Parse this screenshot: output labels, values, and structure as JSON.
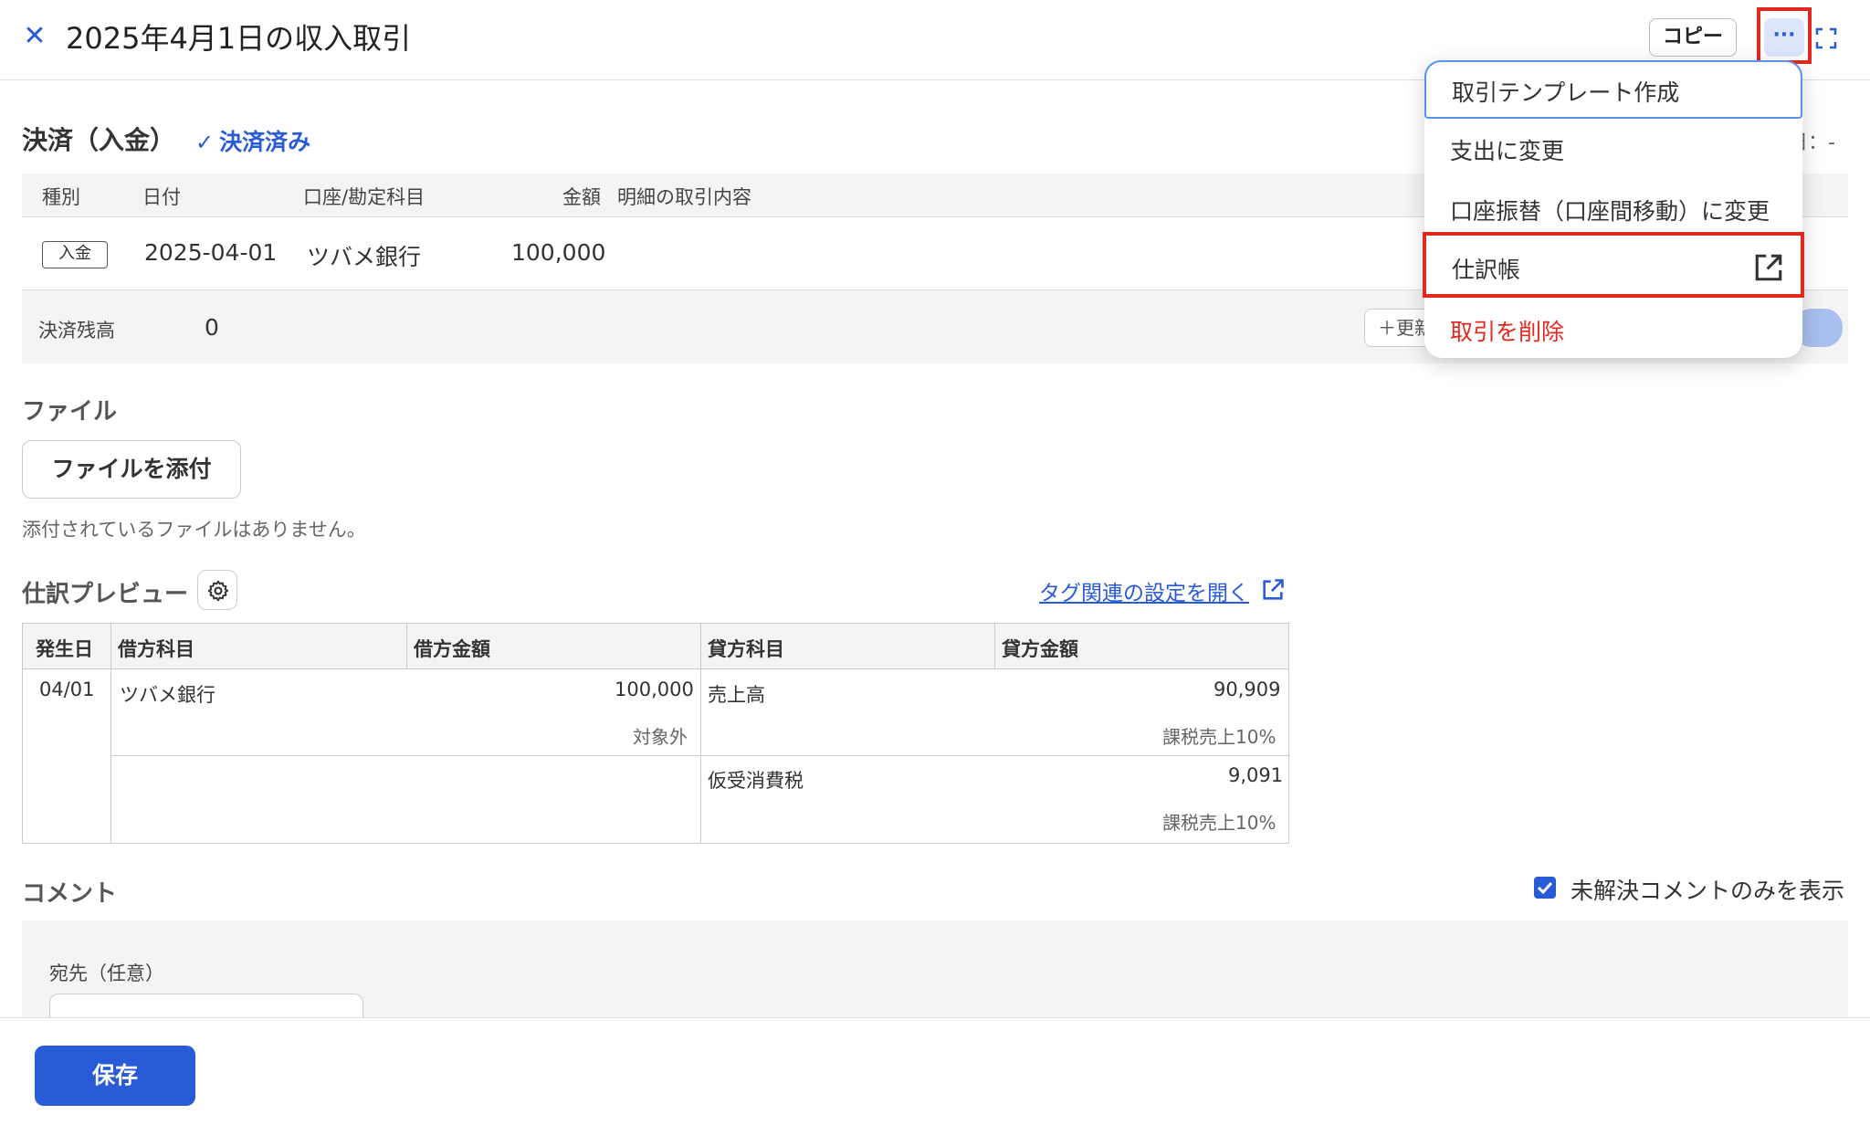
{
  "header": {
    "title": "2025年4月1日の収入取引",
    "copy_label": "コピー",
    "more_label": "···"
  },
  "settlement": {
    "title": "決済（入金）",
    "status": "決済済み",
    "right_text": "日：-",
    "columns": [
      "種別",
      "日付",
      "口座/勘定科目",
      "金額",
      "明細の取引内容"
    ],
    "row": {
      "type": "入金",
      "date": "2025-04-01",
      "account": "ツバメ銀行",
      "amount": "100,000"
    },
    "balance_label": "決済残高",
    "balance_value": "0",
    "update_label": "＋更新"
  },
  "files": {
    "title": "ファイル",
    "attach_label": "ファイルを添付",
    "note": "添付されているファイルはありません。"
  },
  "journal": {
    "title": "仕訳プレビュー",
    "tag_link": "タグ関連の設定を開く",
    "columns": [
      "発生日",
      "借方科目",
      "借方金額",
      "貸方科目",
      "貸方金額"
    ],
    "date": "04/01",
    "debit_account": "ツバメ銀行",
    "debit_amount": "100,000",
    "debit_tax": "対象外",
    "credit1_account": "売上高",
    "credit1_amount": "90,909",
    "credit1_tax": "課税売上10%",
    "credit2_account": "仮受消費税",
    "credit2_amount": "9,091",
    "credit2_tax": "課税売上10%"
  },
  "comment": {
    "title": "コメント",
    "filter_label": "未解決コメントのみを表示",
    "to_label": "宛先（任意）"
  },
  "footer": {
    "save_label": "保存"
  },
  "menu": {
    "items": [
      {
        "label": "取引テンプレート作成"
      },
      {
        "label": "支出に変更"
      },
      {
        "label": "口座振替（口座間移動）に変更"
      },
      {
        "label": "仕訳帳"
      },
      {
        "label": "取引を削除"
      }
    ]
  },
  "colors": {
    "accent": "#2a5bd7",
    "danger": "#e3281f",
    "highlight_box": "#e3281f"
  }
}
